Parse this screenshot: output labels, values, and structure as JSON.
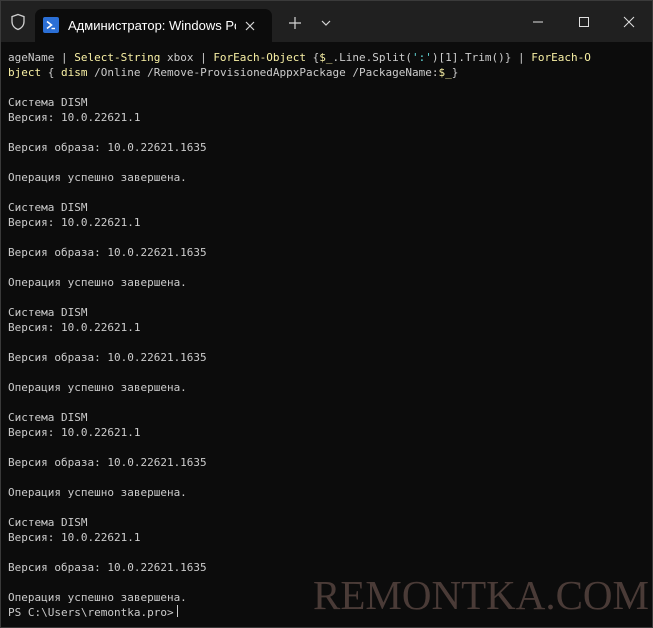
{
  "window": {
    "tab_title": "Администратор: Windows PowerShell"
  },
  "icons": {
    "shield": "shield-icon",
    "tab": "powershell-icon",
    "tab_close": "close-icon",
    "new_tab": "plus-icon",
    "dropdown": "chevron-down-icon",
    "minimize": "minimize-icon",
    "maximize": "maximize-icon",
    "close": "close-icon"
  },
  "console": {
    "command": {
      "l1_a": "ageName | ",
      "l1_b": "Select-String",
      "l1_c": " xbox | ",
      "l1_d": "ForEach-Object",
      "l1_e": " {",
      "l1_f": "$_",
      "l1_g": ".Line.Split(",
      "l1_h": "':'",
      "l1_i": ")[1].Trim()} | ",
      "l1_j": "ForEach-O",
      "l2_a": "bject",
      "l2_b": " { ",
      "l2_c": "dism",
      "l2_d": " /Online /Remove-ProvisionedAppxPackage /PackageName:",
      "l2_e": "$_",
      "l2_f": "}"
    },
    "lines": [
      "Система DISM",
      "Версия: 10.0.22621.1",
      "Версия образа: 10.0.22621.1635",
      "Операция успешно завершена.",
      "Система DISM",
      "Версия: 10.0.22621.1",
      "Версия образа: 10.0.22621.1635",
      "Операция успешно завершена.",
      "Система DISM",
      "Версия: 10.0.22621.1",
      "Версия образа: 10.0.22621.1635",
      "Операция успешно завершена.",
      "Система DISM",
      "Версия: 10.0.22621.1",
      "Версия образа: 10.0.22621.1635",
      "Операция успешно завершена.",
      "Система DISM",
      "Версия: 10.0.22621.1",
      "Версия образа: 10.0.22621.1635",
      "Операция успешно завершена."
    ],
    "prompt": "PS C:\\Users\\remontka.pro>"
  },
  "watermark": "REMONTKA.COM"
}
